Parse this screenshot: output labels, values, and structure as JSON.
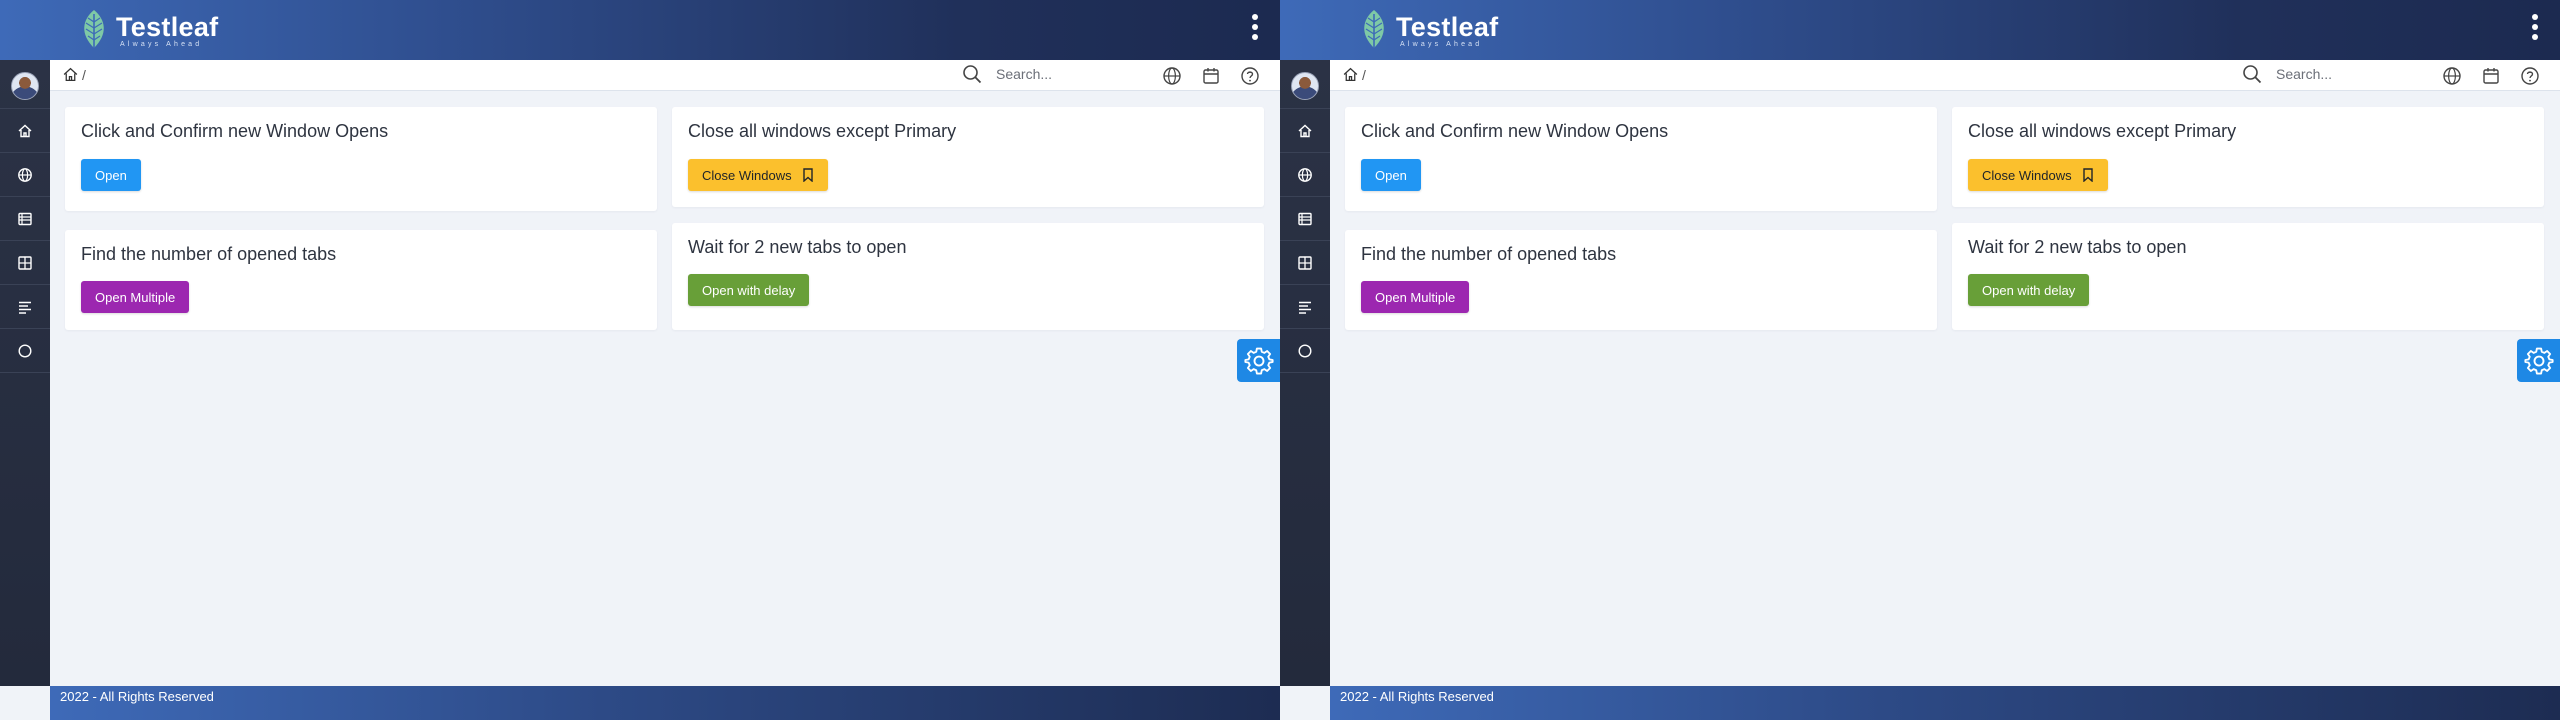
{
  "brand": {
    "name": "Testleaf",
    "tagline": "Always Ahead"
  },
  "header": {
    "menu_icon": "kebab-menu-icon"
  },
  "sidebar": {
    "items": [
      {
        "icon": "home-icon"
      },
      {
        "icon": "globe-icon"
      },
      {
        "icon": "list-icon"
      },
      {
        "icon": "grid-icon"
      },
      {
        "icon": "align-left-icon"
      },
      {
        "icon": "circle-icon"
      }
    ]
  },
  "breadcrumb": {
    "icon": "home-icon",
    "separator": "/"
  },
  "search": {
    "placeholder": "Search..."
  },
  "toolbar_icons": [
    "globe-icon",
    "calendar-icon",
    "help-icon"
  ],
  "cards": {
    "open": {
      "title": "Click and Confirm new Window Opens",
      "button": "Open"
    },
    "close": {
      "title": "Close all windows except Primary",
      "button": "Close Windows"
    },
    "multiple": {
      "title": "Find the number of opened tabs",
      "button": "Open Multiple"
    },
    "delay": {
      "title": "Wait for 2 new tabs to open",
      "button": "Open with delay"
    }
  },
  "footer": {
    "text": "2022 - All Rights Reserved"
  },
  "colors": {
    "open_button": "#2196f3",
    "close_button": "#fbc02d",
    "multiple_button": "#9c27b0",
    "delay_button": "#689f38",
    "settings_tab": "#1e88e5"
  }
}
